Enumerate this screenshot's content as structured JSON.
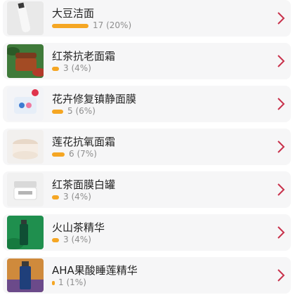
{
  "accent": "#f5a623",
  "chevron_color": "#c8314b",
  "products": [
    {
      "name": "大豆洁面",
      "count": "17",
      "percent": "20%",
      "fraction": 0.2,
      "thumb": "cleanser-tube"
    },
    {
      "name": "红茶抗老面霜",
      "count": "3",
      "percent": "4%",
      "fraction": 0.04,
      "thumb": "red-tea-cream-jar"
    },
    {
      "name": "花卉修复镇静面膜",
      "count": "5",
      "percent": "6%",
      "fraction": 0.06,
      "thumb": "flower-mask-jar"
    },
    {
      "name": "莲花抗氧面霜",
      "count": "6",
      "percent": "7%",
      "fraction": 0.07,
      "thumb": "lotus-cream-jar"
    },
    {
      "name": "红茶面膜白罐",
      "count": "3",
      "percent": "4%",
      "fraction": 0.04,
      "thumb": "white-mask-jar"
    },
    {
      "name": "火山茶精华",
      "count": "3",
      "percent": "4%",
      "fraction": 0.04,
      "thumb": "volcano-serum-bottle"
    },
    {
      "name": "AHA果酸睡莲精华",
      "count": "1",
      "percent": "1%",
      "fraction": 0.01,
      "thumb": "aha-serum-bottle"
    }
  ]
}
